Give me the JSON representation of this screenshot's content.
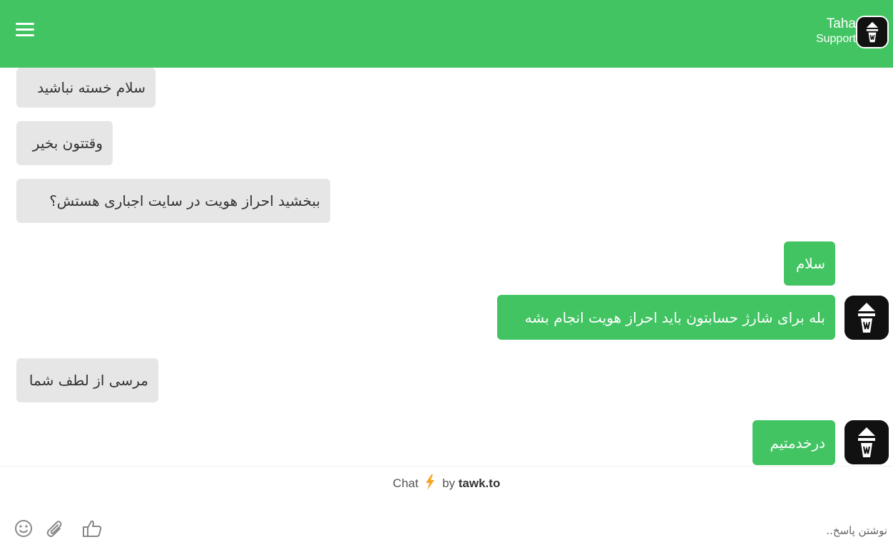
{
  "header": {
    "agent_name": "Taha",
    "agent_role": "Support",
    "bg_color": "#43c463"
  },
  "messages": [
    {
      "sender": "visitor",
      "text": "سلام خسته نباشید"
    },
    {
      "sender": "visitor",
      "text": "وقتتون بخیر"
    },
    {
      "sender": "visitor",
      "text": "ببخشید احراز هویت در سایت اجباری هستش؟"
    },
    {
      "sender": "agent",
      "text": "سلام"
    },
    {
      "sender": "agent",
      "text": "بله برای شارژ حسابتون باید احراز هویت انجام بشه"
    },
    {
      "sender": "visitor",
      "text": "مرسی از لطف شما"
    },
    {
      "sender": "agent",
      "text": "درخدمتیم"
    }
  ],
  "branding": {
    "prefix": "Chat",
    "by": "by",
    "brand": "tawk.to"
  },
  "composer": {
    "placeholder": "نوشتن پاسخ..",
    "icons": [
      "emoji-icon",
      "attachment-icon",
      "thumbs-up-icon"
    ]
  },
  "colors": {
    "agent_bubble": "#43c463",
    "visitor_bubble": "#e6e6e6"
  }
}
